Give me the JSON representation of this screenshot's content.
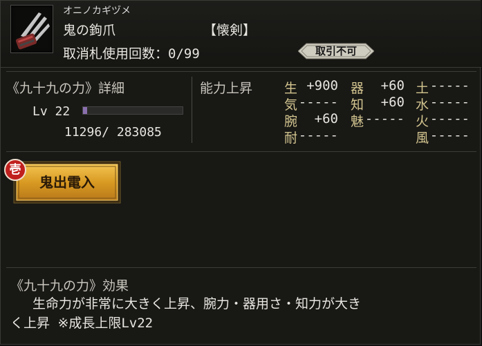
{
  "item": {
    "ruby": "オニノカギヅメ",
    "name": "鬼の鉤爪",
    "type": "【懐剣】",
    "uses_label": "取消札使用回数：0/99",
    "badge": "取引不可",
    "icon": "claw-weapon-icon"
  },
  "power": {
    "title": "《九十九の力》詳細",
    "level_label": "Lv 22",
    "exp_progress": 0.04,
    "exp_text": "11296/  283085"
  },
  "ability": {
    "title": "能力上昇",
    "stats": [
      {
        "k": "生",
        "v": "+900"
      },
      {
        "k": "器",
        "v": "+60"
      },
      {
        "k": "土",
        "v": "-----"
      },
      {
        "k": "気",
        "v": "-----"
      },
      {
        "k": "知",
        "v": "+60"
      },
      {
        "k": "水",
        "v": "-----"
      },
      {
        "k": "腕",
        "v": "+60"
      },
      {
        "k": "魅",
        "v": "-----"
      },
      {
        "k": "火",
        "v": "-----"
      },
      {
        "k": "耐",
        "v": "-----"
      },
      {
        "k": "風",
        "v": "-----"
      }
    ]
  },
  "skill": {
    "rank": "壱",
    "label": "鬼出電入"
  },
  "effect": {
    "title": "《九十九の力》効果",
    "line1": "生命力が非常に大きく上昇、腕力・器用さ・知力が大き",
    "line2": "く上昇 ※成長上限Lv22"
  },
  "colors": {
    "accent_gold": "#d9a326",
    "stat_label": "#d4c690",
    "exp_fill": "#8a6fae",
    "badge_red": "#c0201e"
  }
}
